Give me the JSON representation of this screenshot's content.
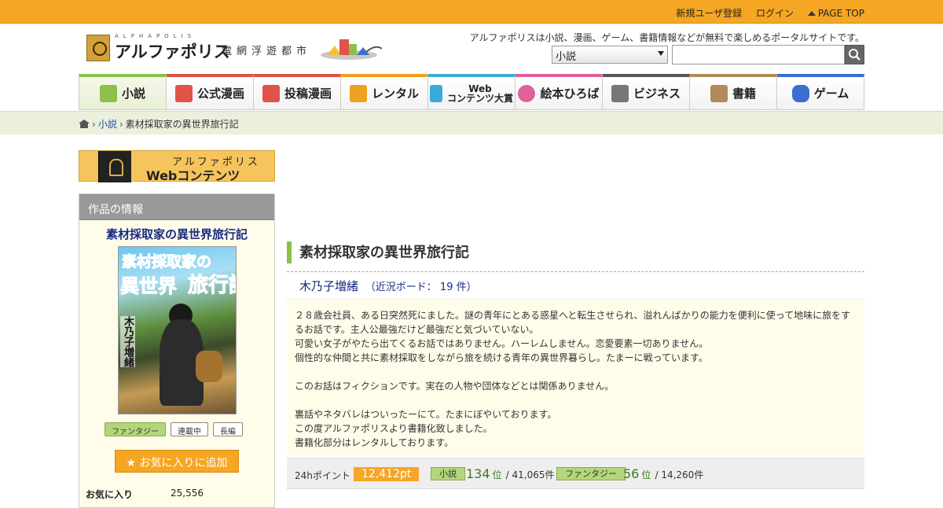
{
  "topbar": {
    "register": "新規ユーザ登録",
    "login": "ログイン",
    "page_top": "PAGE TOP"
  },
  "logo": {
    "sub": "ALPHAPOLIS",
    "main": "アルファポリス",
    "tag": "電網浮遊都市"
  },
  "header": {
    "tagline": "アルファポリスは小説、漫画、ゲーム、書籍情報などが無料で楽しめるポータルサイトです。",
    "search_category": "小説",
    "search_placeholder": ""
  },
  "nav": {
    "items": [
      {
        "label": "小説",
        "color": "#8cc04a"
      },
      {
        "label": "公式漫画",
        "color": "#e0534a"
      },
      {
        "label": "投稿漫画",
        "color": "#e0534a"
      },
      {
        "label": "レンタル",
        "color": "#f0a020"
      },
      {
        "label_line1": "Web",
        "label_line2": "コンテンツ大賞",
        "color": "#3aaad8"
      },
      {
        "label": "絵本ひろば",
        "color": "#e0609a"
      },
      {
        "label": "ビジネス",
        "color": "#555555"
      },
      {
        "label": "書籍",
        "color": "#b08a5a"
      },
      {
        "label": "ゲーム",
        "color": "#3a6fd0"
      }
    ]
  },
  "breadcrumb": {
    "level1": "小説",
    "current": "素材採取家の異世界旅行記"
  },
  "banner": {
    "line1": "アルファポリス",
    "line2": "Webコンテンツ"
  },
  "sidebar": {
    "heading": "作品の情報",
    "title": "素材採取家の異世界旅行記",
    "cover": {
      "line1": "素材採取家の",
      "line2": "異世界",
      "line3": "旅行記",
      "author": "木乃子増緒"
    },
    "tags": [
      "ファンタジー",
      "連載中",
      "長編"
    ],
    "fav_button": "お気に入りに追加",
    "stat_label": "お気に入り",
    "stat_value": "25,556"
  },
  "main": {
    "title": "素材採取家の異世界旅行記",
    "author": "木乃子増緒",
    "board": "（近況ボード： 19 件）",
    "description": "２８歳会社員、ある日突然死にました。謎の青年にとある惑星へと転生させられ、溢れんばかりの能力を便利に使って地味に旅をするお話です。主人公最強だけど最強だと気づいていない。\n可愛い女子がやたら出てくるお話ではありません。ハーレムしません。恋愛要素一切ありません。\n個性的な仲間と共に素材採取をしながら旅を続ける青年の異世界暮らし。たまーに戦っています。\n\nこのお話はフィクションです。実在の人物や団体などとは関係ありません。\n\n裏話やネタバレはついったーにて。たまにぼやいております。\nこの度アルファポリスより書籍化致しました。\n書籍化部分はレンタルしております。"
  },
  "ranking": {
    "label": "24hポイント",
    "points": "12,412pt",
    "cat1": "小説",
    "cat1_rank": "134",
    "cat1_unit": "位",
    "cat1_total": "/ 41,065件",
    "cat2": "ファンタジー",
    "cat2_rank": "56",
    "cat2_unit": "位",
    "cat2_total": "/ 14,260件"
  }
}
